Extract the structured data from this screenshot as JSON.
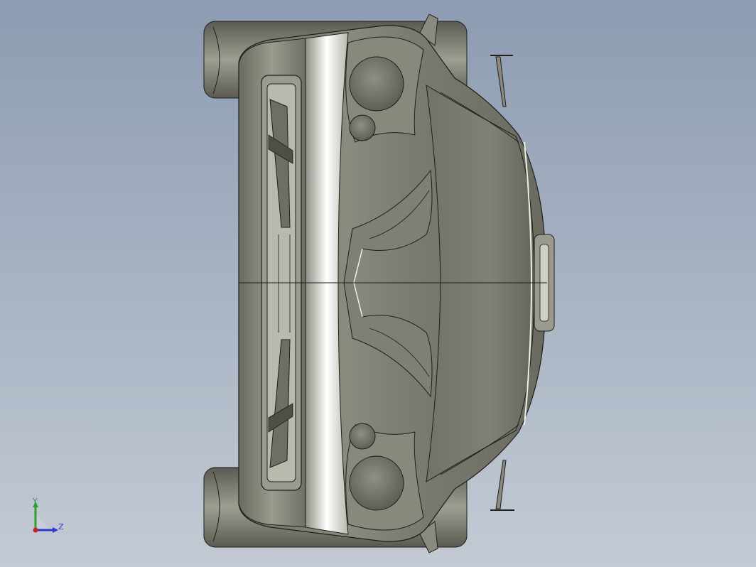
{
  "viewport": {
    "background_top": "#8d9cb2",
    "background_bottom": "#c3cad4"
  },
  "model": {
    "shading_color": "#7c7c70",
    "highlight_color": "#f4f4ee",
    "edge_color": "#1e1e1a"
  },
  "triad": {
    "y_label": "Y",
    "z_label": "Z",
    "y_color": "#2fa02f",
    "z_color": "#2a3ad0",
    "origin_color": "#d02020"
  }
}
